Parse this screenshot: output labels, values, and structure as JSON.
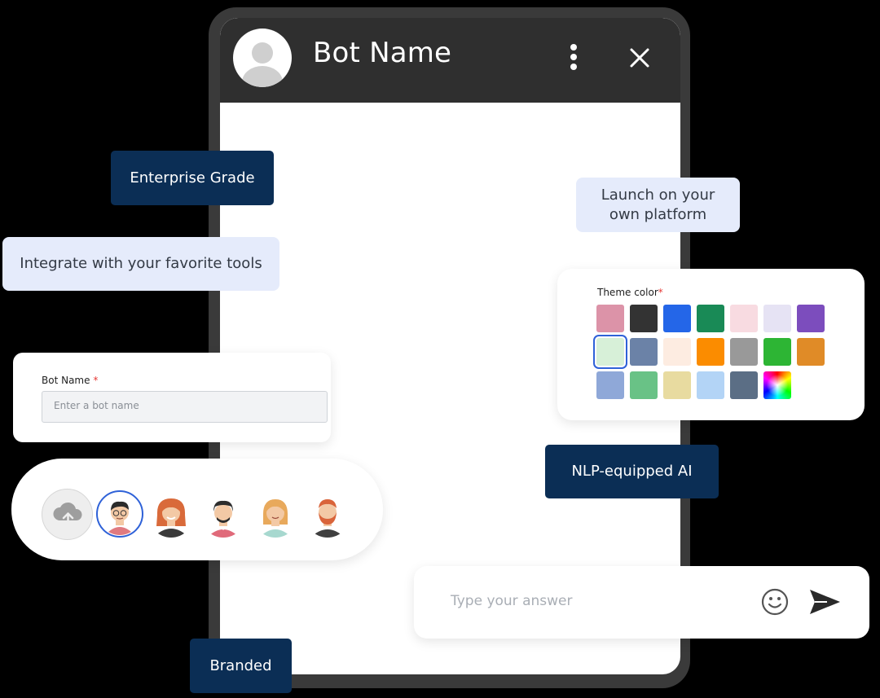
{
  "chat": {
    "title": "Bot Name",
    "answer_placeholder": "Type your answer"
  },
  "features": {
    "enterprise": "Enterprise Grade",
    "integrate": "Integrate with your favorite tools",
    "launch": "Launch on your own platform",
    "nlp": "NLP-equipped AI",
    "branded": "Branded"
  },
  "bot_name_form": {
    "label": "Bot Name",
    "required_mark": "*",
    "placeholder": "Enter a bot name"
  },
  "theme": {
    "label": "Theme color",
    "required_mark": "*",
    "swatches": [
      "#dc93a8",
      "#333333",
      "#2466e8",
      "#198a56",
      "#f8dbe1",
      "#e6e3f4",
      "#7c4dbd",
      "#d7f0d8",
      "#6b82a7",
      "#fdece1",
      "#fb8c00",
      "#999999",
      "#2db534",
      "#e08b27",
      "#8fa8d8",
      "#69c286",
      "#e8dba0",
      "#b3d4f6",
      "#5b6e85",
      "rainbow"
    ],
    "selected_index": 7
  },
  "avatars": {
    "upload_icon": "cloud-upload-icon",
    "selected_index": 0,
    "items": [
      "avatar-man-glasses",
      "avatar-woman-red-hair",
      "avatar-man-dark-hair",
      "avatar-woman-blonde",
      "avatar-man-beard"
    ]
  },
  "icons": {
    "menu": "kebab-menu-icon",
    "close": "close-icon",
    "emoji": "emoji-icon",
    "send": "send-icon"
  }
}
